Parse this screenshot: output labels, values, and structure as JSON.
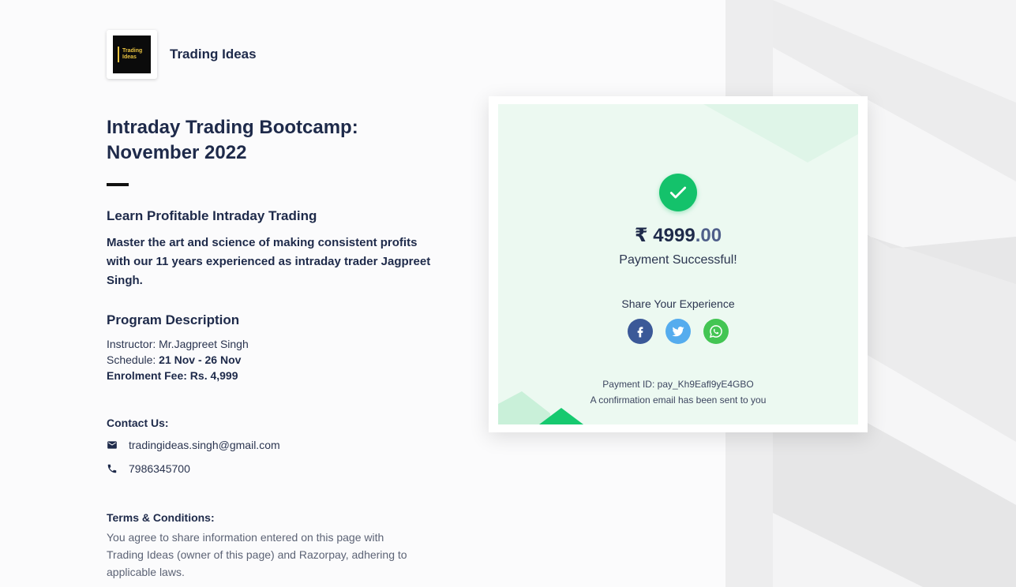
{
  "brand": {
    "logo_text": "Trading Ideas",
    "name": "Trading Ideas"
  },
  "page": {
    "title": "Intraday Trading Bootcamp: November 2022",
    "learn_heading": "Learn Profitable Intraday Trading",
    "lead": "Master the art and science of making consistent profits with our 11 years experienced as intraday trader Jagpreet Singh.",
    "program_heading": "Program Description",
    "instructor": "Instructor: Mr.Jagpreet Singh",
    "schedule_label": "Schedule: ",
    "schedule_value": "21 Nov - 26 Nov",
    "fee": "Enrolment Fee: Rs. 4,999"
  },
  "contact": {
    "heading": "Contact Us:",
    "email": "tradingideas.singh@gmail.com",
    "phone": "7986345700"
  },
  "terms": {
    "heading": "Terms & Conditions:",
    "text": "You agree to share information entered on this page with Trading Ideas (owner of this page) and Razorpay, adhering to applicable laws."
  },
  "payment": {
    "amount_main": "₹ 4999",
    "amount_decimal": ".00",
    "status": "Payment Successful!",
    "share_label": "Share Your Experience",
    "payment_id": "Payment ID: pay_Kh9Eafl9yE4GBO",
    "confirmation": "A confirmation email has been sent to you"
  },
  "icons": {
    "check": "check-icon",
    "facebook": "facebook-icon",
    "twitter": "twitter-icon",
    "whatsapp": "whatsapp-icon",
    "mail": "mail-icon",
    "phone": "phone-icon"
  },
  "colors": {
    "success": "#14c26b",
    "facebook": "#3b5998",
    "twitter": "#55acee",
    "whatsapp": "#43c553",
    "navy": "#1e2a4a"
  }
}
